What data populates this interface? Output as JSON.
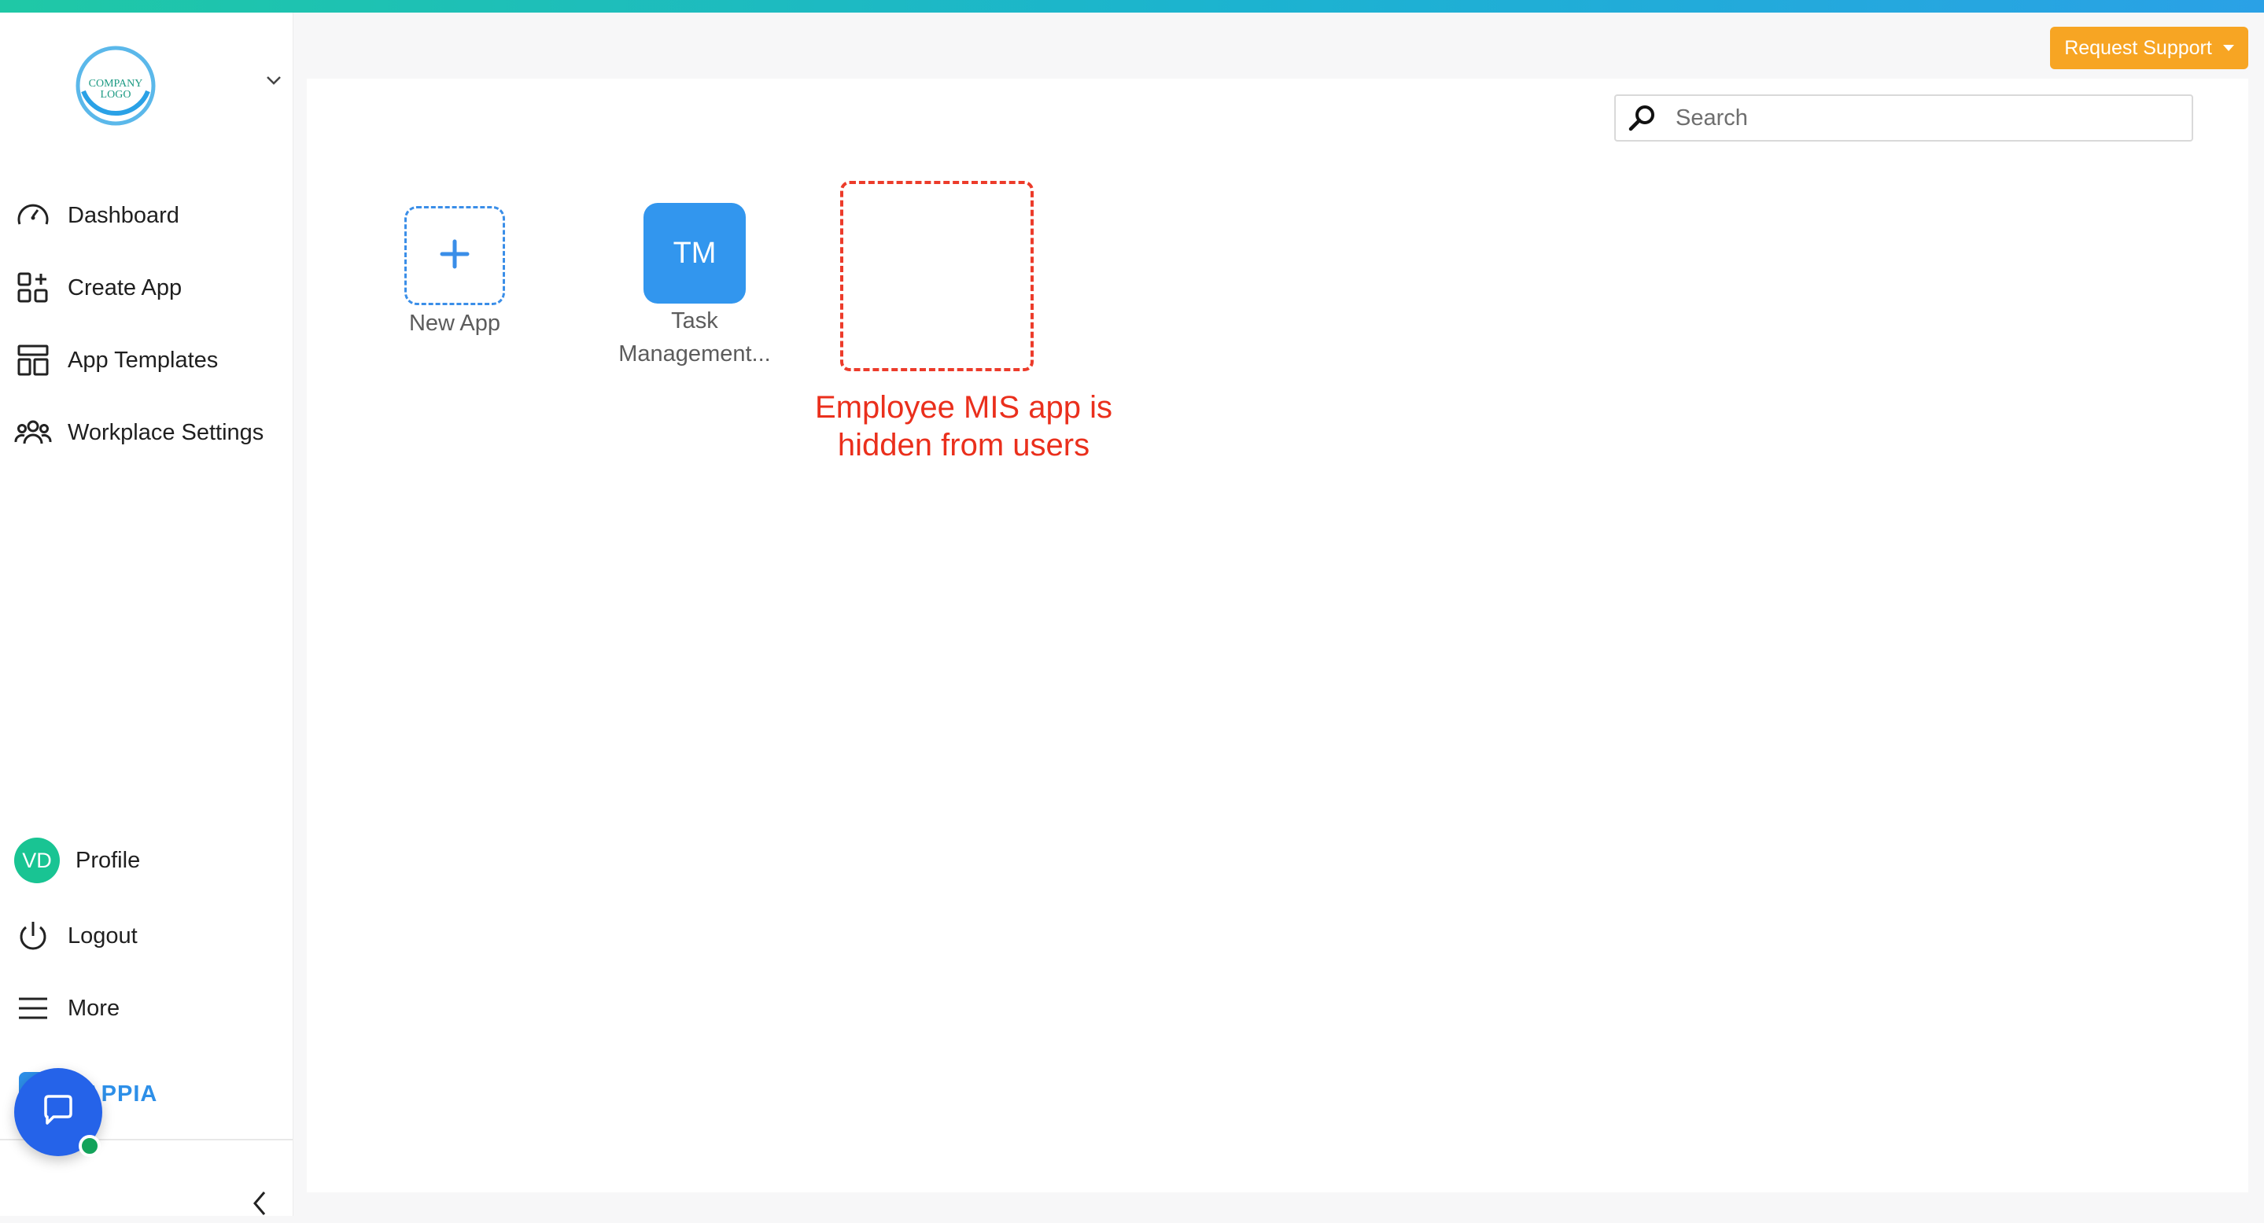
{
  "sidebar": {
    "logo_text": "COMPANY LOGO",
    "nav": {
      "dashboard": "Dashboard",
      "create_app": "Create App",
      "app_templates": "App Templates",
      "workplace_settings": "Workplace Settings"
    },
    "profile": {
      "initials": "VD",
      "label": "Profile"
    },
    "logout": "Logout",
    "more": "More",
    "brand": "LAPPIA"
  },
  "header": {
    "request_support": "Request Support"
  },
  "search": {
    "placeholder": "Search"
  },
  "apps": [
    {
      "label": "New App"
    },
    {
      "initials": "TM",
      "label_line1": "Task",
      "label_line2": "Management..."
    }
  ],
  "annotation": {
    "line1": "Employee MIS app is",
    "line2": "hidden from users"
  },
  "colors": {
    "accent": "#3296ee",
    "support": "#f7a523",
    "avatar": "#19c493",
    "annotation": "#ea2f1c",
    "chat_fab": "#2563e9"
  }
}
